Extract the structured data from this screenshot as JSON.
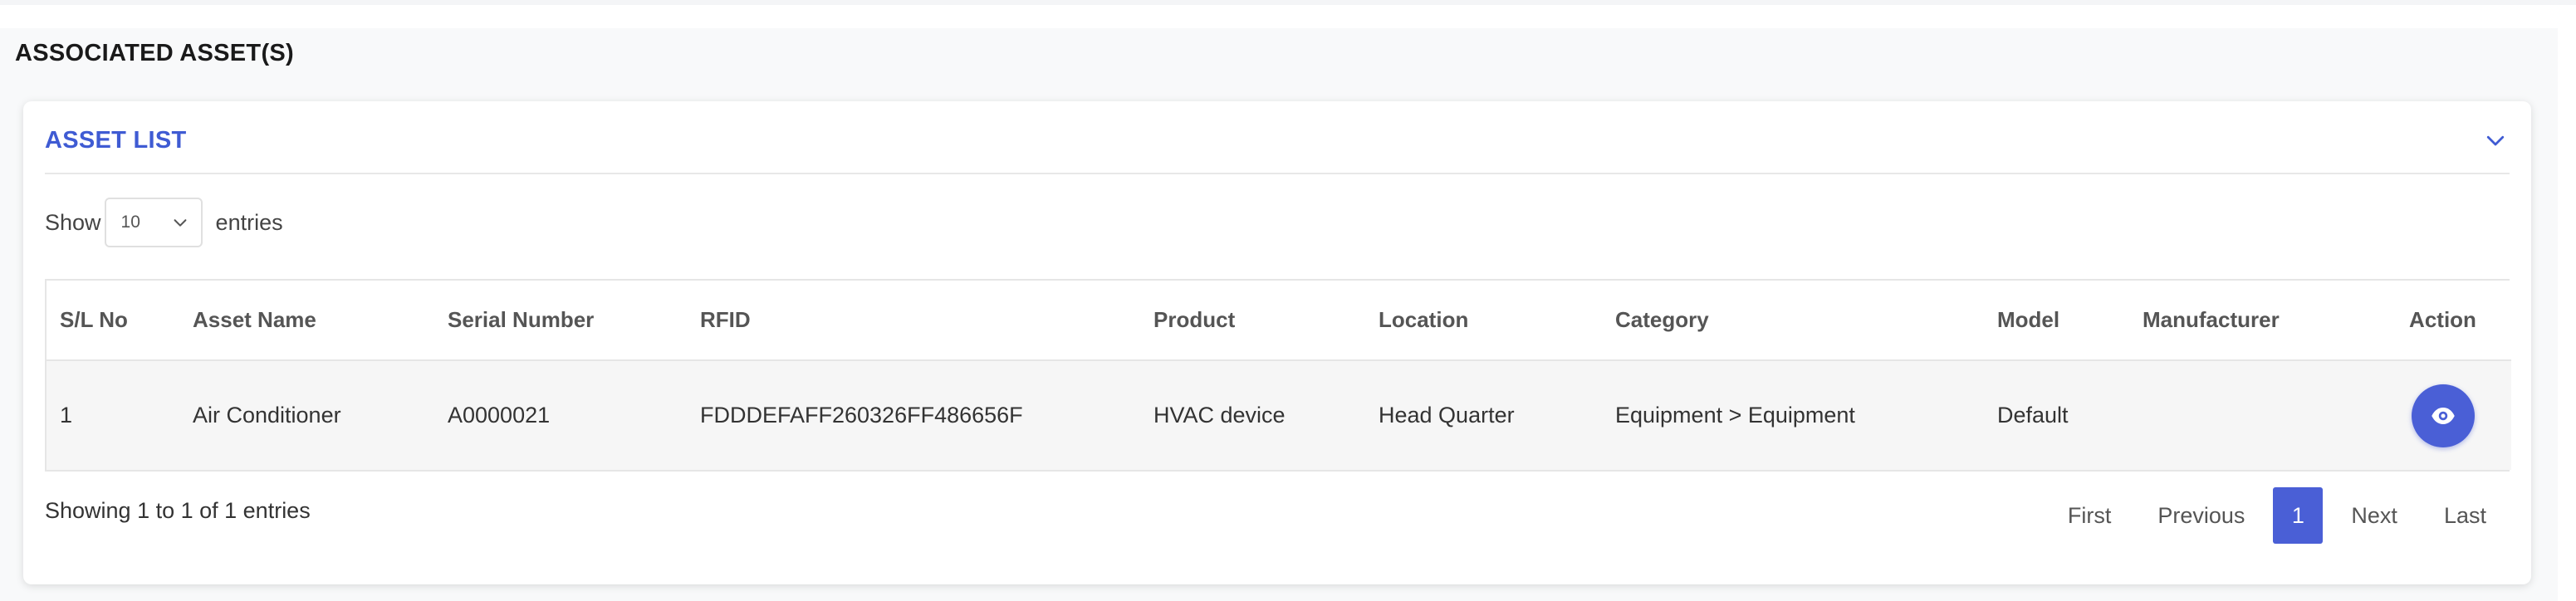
{
  "section": {
    "title": "ASSOCIATED ASSET(S)"
  },
  "card": {
    "title": "ASSET LIST"
  },
  "length": {
    "show_label": "Show",
    "value": "10",
    "entries_label": "entries"
  },
  "table": {
    "columns": [
      "S/L No",
      "Asset Name",
      "Serial Number",
      "RFID",
      "Product",
      "Location",
      "Category",
      "Model",
      "Manufacturer",
      "Action"
    ],
    "rows": [
      [
        "1",
        "Air Conditioner",
        "A0000021",
        "FDDDEFAFF260326FF486656F",
        "HVAC device",
        "Head Quarter",
        "Equipment > Equipment",
        "Default",
        ""
      ]
    ]
  },
  "info": "Showing 1 to 1 of 1 entries",
  "pager": {
    "first": "First",
    "previous": "Previous",
    "current": "1",
    "next": "Next",
    "last": "Last"
  },
  "colors": {
    "accent": "#4a5fd6",
    "title_blue": "#3f5bd3"
  },
  "icons": {
    "collapse": "chevron-down-icon",
    "view": "eye-icon"
  }
}
